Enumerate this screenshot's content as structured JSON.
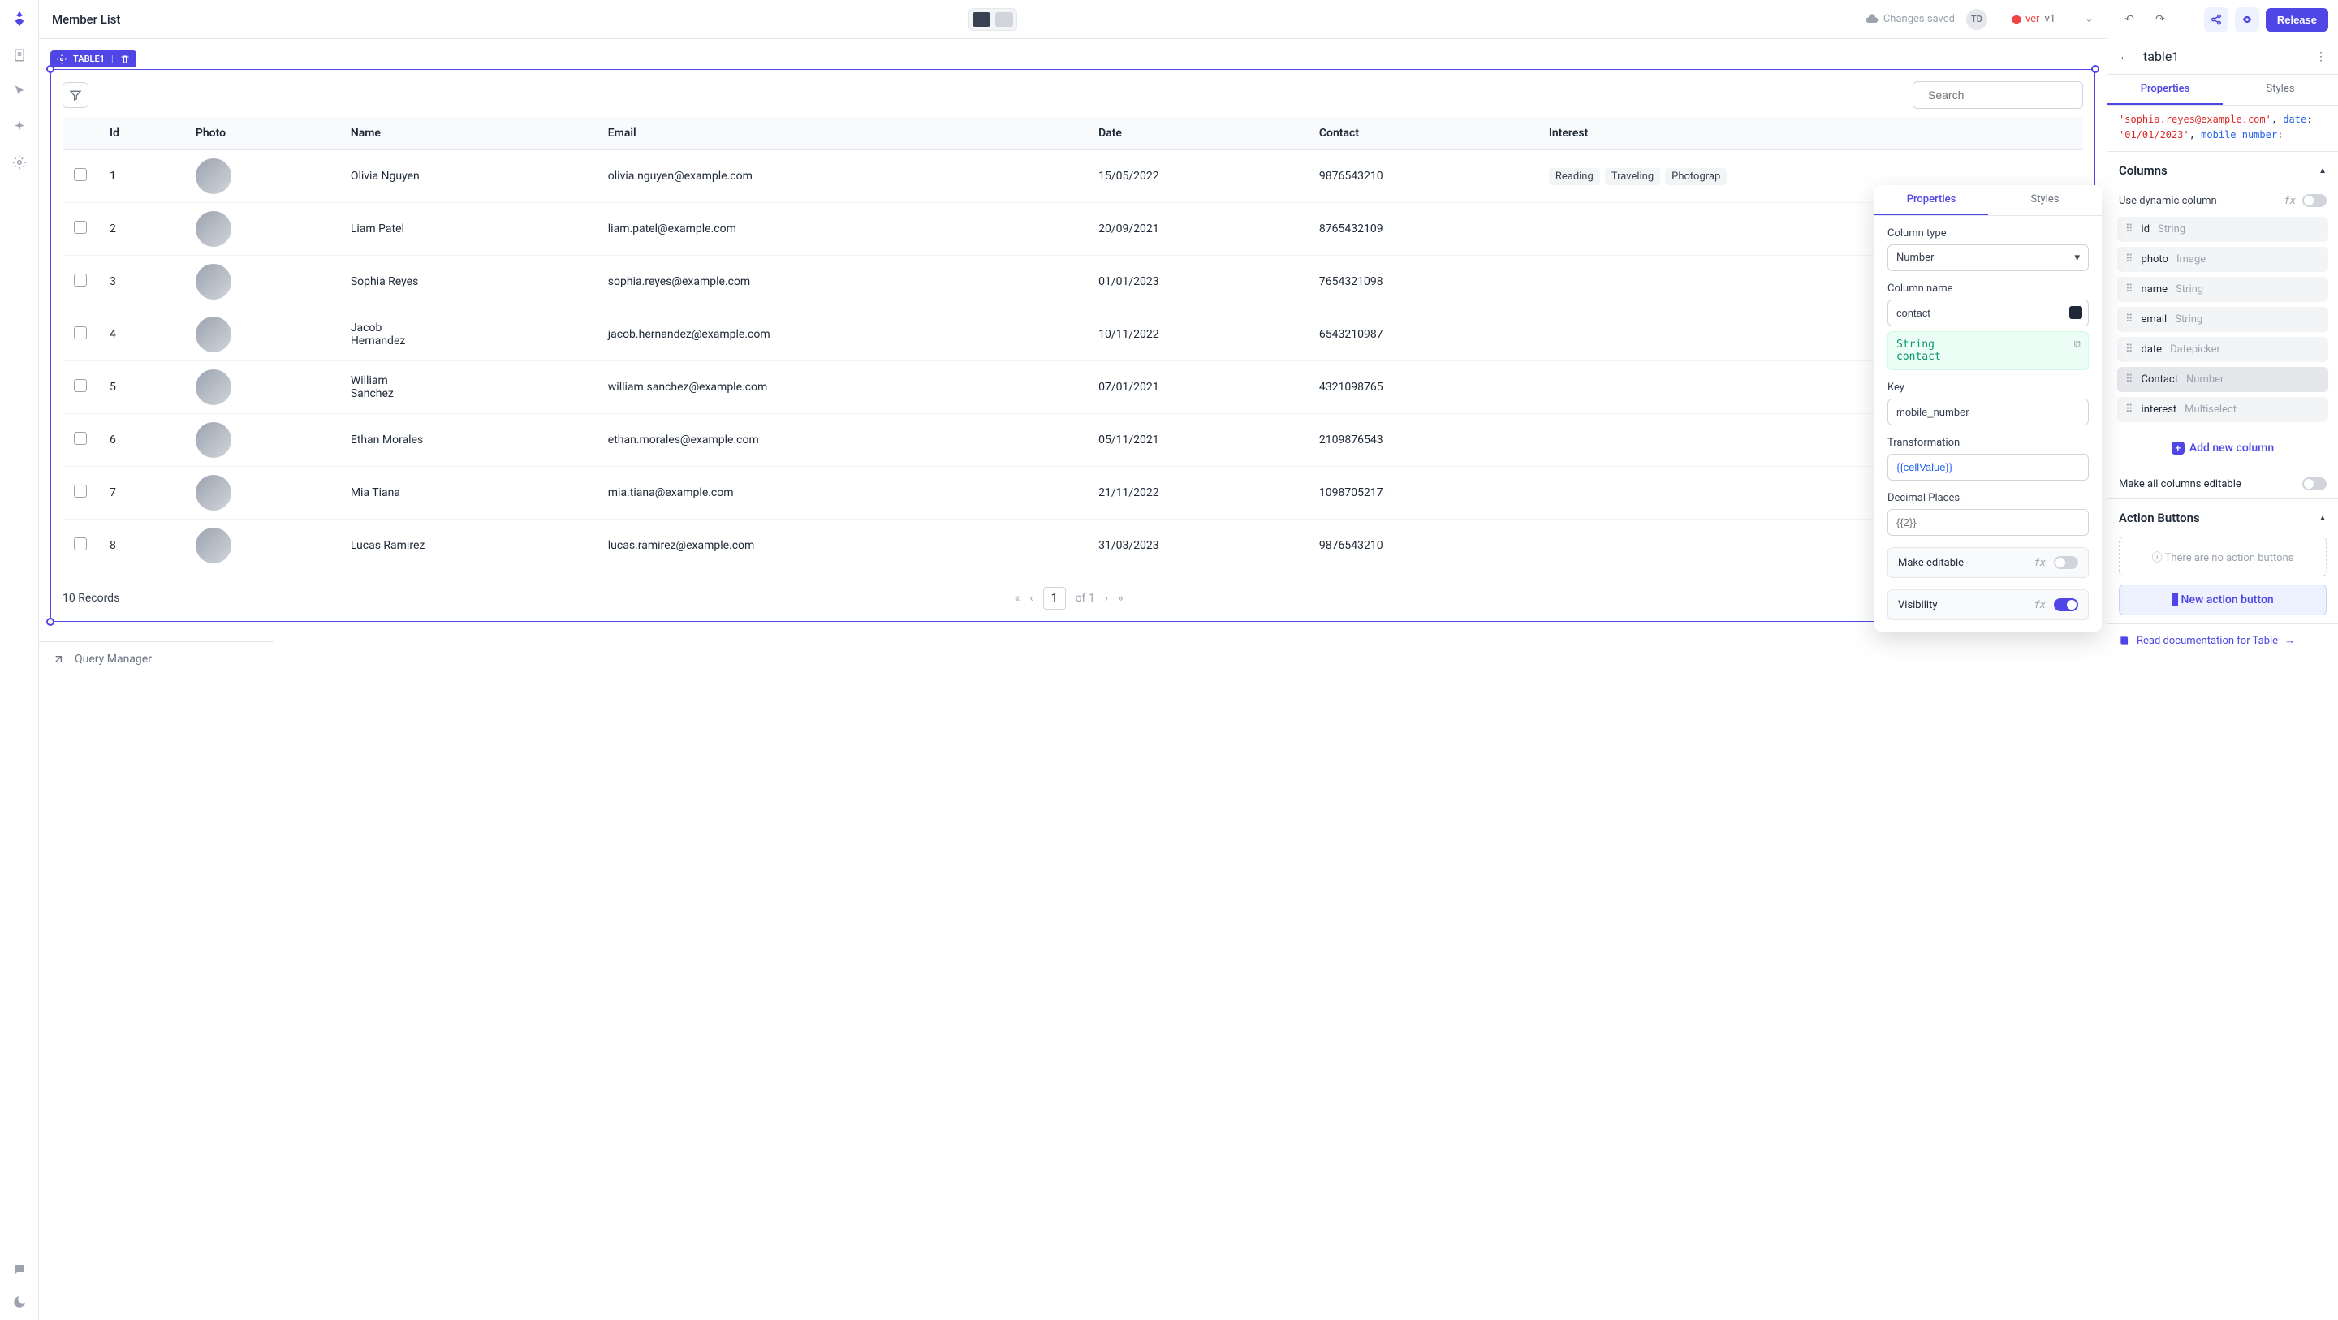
{
  "header": {
    "title": "Member List",
    "saved_text": "Changes saved",
    "avatar_initials": "TD",
    "version_label": "ver",
    "version_value": "v1",
    "release_btn": "Release"
  },
  "widget": {
    "tag": "TABLE1",
    "search_placeholder": "Search"
  },
  "table": {
    "headers": [
      "Id",
      "Photo",
      "Name",
      "Email",
      "Date",
      "Contact",
      "Interest"
    ],
    "rows": [
      {
        "id": "1",
        "name": "Olivia Nguyen",
        "email": "olivia.nguyen@example.com",
        "date": "15/05/2022",
        "contact": "9876543210",
        "interests": [
          "Reading",
          "Traveling",
          "Photograp"
        ]
      },
      {
        "id": "2",
        "name": "Liam Patel",
        "email": "liam.patel@example.com",
        "date": "20/09/2021",
        "contact": "8765432109",
        "interests": []
      },
      {
        "id": "3",
        "name": "Sophia Reyes",
        "email": "sophia.reyes@example.com",
        "date": "01/01/2023",
        "contact": "7654321098",
        "interests": []
      },
      {
        "id": "4",
        "name": "Jacob Hernandez",
        "email": "jacob.hernandez@example.com",
        "date": "10/11/2022",
        "contact": "6543210987",
        "interests": []
      },
      {
        "id": "5",
        "name": "William Sanchez",
        "email": "william.sanchez@example.com",
        "date": "07/01/2021",
        "contact": "4321098765",
        "interests": []
      },
      {
        "id": "6",
        "name": "Ethan Morales",
        "email": "ethan.morales@example.com",
        "date": "05/11/2021",
        "contact": "2109876543",
        "interests": []
      },
      {
        "id": "7",
        "name": "Mia Tiana",
        "email": "mia.tiana@example.com",
        "date": "21/11/2022",
        "contact": "1098705217",
        "interests": []
      },
      {
        "id": "8",
        "name": "Lucas Ramirez",
        "email": "lucas.ramirez@example.com",
        "date": "31/03/2023",
        "contact": "9876543210",
        "interests": []
      }
    ],
    "records_label": "10 Records",
    "page_current": "1",
    "page_of": "of 1"
  },
  "inspector": {
    "element_name": "table1",
    "tabs": {
      "properties": "Properties",
      "styles": "Styles"
    },
    "json_preview": {
      "email": "'sophia.reyes@example.com'",
      "date_k": "date",
      "date_v": "'01/01/2023'",
      "mobile_k": "mobile_number"
    },
    "columns_title": "Columns",
    "dynamic_label": "Use dynamic column",
    "columns": [
      {
        "name": "id",
        "type": "String"
      },
      {
        "name": "photo",
        "type": "Image"
      },
      {
        "name": "name",
        "type": "String"
      },
      {
        "name": "email",
        "type": "String"
      },
      {
        "name": "date",
        "type": "Datepicker"
      },
      {
        "name": "Contact",
        "type": "Number",
        "selected": true
      },
      {
        "name": "interest",
        "type": "Multiselect"
      }
    ],
    "add_column": "Add new column",
    "make_editable": "Make all columns editable",
    "action_title": "Action Buttons",
    "no_actions": "There are no action buttons",
    "new_action": "New action button",
    "docs": "Read documentation for Table"
  },
  "popover": {
    "tabs": {
      "properties": "Properties",
      "styles": "Styles"
    },
    "column_type_label": "Column type",
    "column_type_value": "Number",
    "column_name_label": "Column name",
    "column_name_value": "contact",
    "hint_line1": "String",
    "hint_line2": "contact",
    "key_label": "Key",
    "key_value": "mobile_number",
    "transformation_label": "Transformation",
    "transformation_value": "{{cellValue}}",
    "decimal_label": "Decimal Places",
    "decimal_placeholder": "{{2}}",
    "make_editable": "Make editable",
    "visibility": "Visibility"
  },
  "querybar": {
    "label": "Query Manager"
  }
}
